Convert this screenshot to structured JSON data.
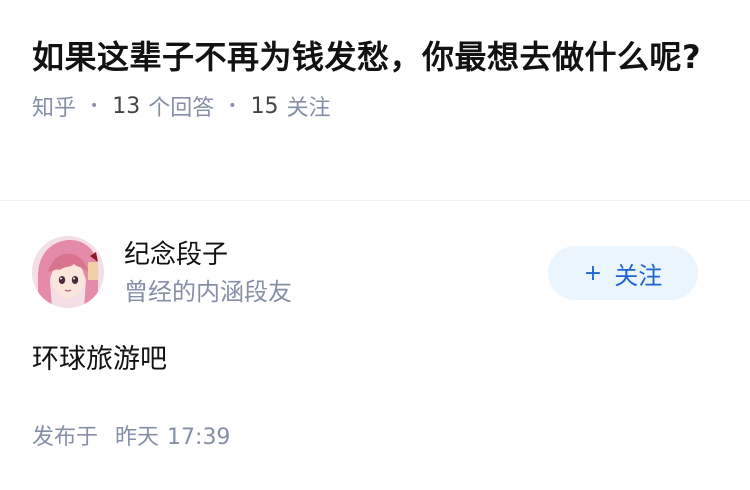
{
  "question": {
    "title": "如果这辈子不再为钱发愁，你最想去做什么呢?",
    "source": "知乎",
    "answer_count": "13",
    "answer_label": "个回答",
    "follower_count": "15",
    "follower_label": "关注"
  },
  "author": {
    "name": "纪念段子",
    "description": "曾经的内涵段友",
    "avatar": "anime-girl-avatar",
    "follow_plus": "+",
    "follow_label": "关注"
  },
  "answer": {
    "text": "环球旅游吧"
  },
  "footer": {
    "published_label": "发布于",
    "published_day": "昨天",
    "published_time": "17:39"
  },
  "colors": {
    "text_primary": "#121212",
    "text_secondary": "#8590a6",
    "follow_bg": "#ebf5fd",
    "follow_text": "#1e64d3"
  }
}
